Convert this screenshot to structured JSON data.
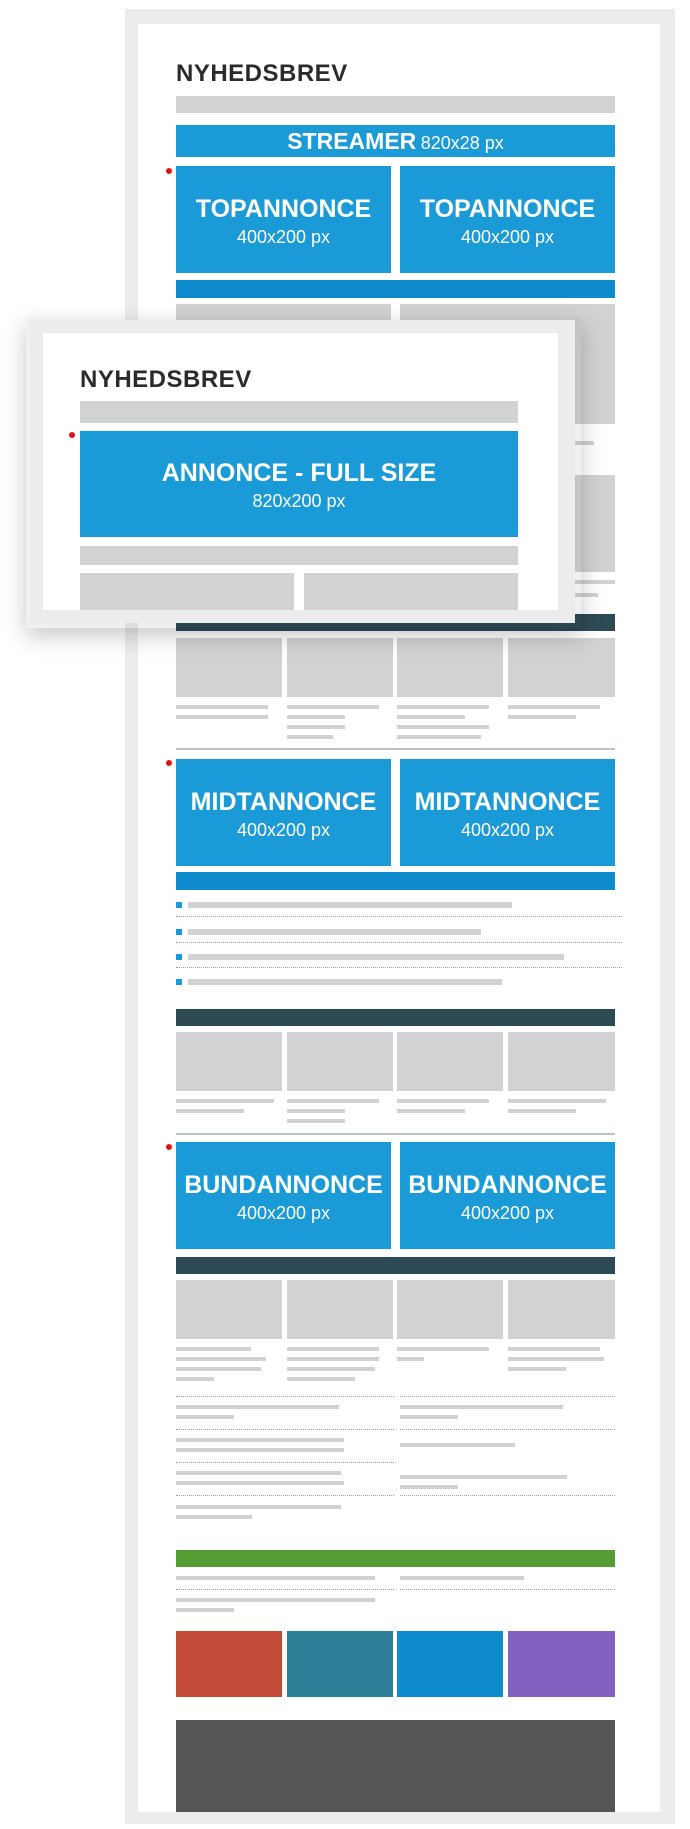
{
  "newsletter": {
    "title": "NYHEDSBREV",
    "streamer": {
      "label": "STREAMER",
      "size": "820x28 px"
    },
    "top_ads": [
      {
        "label": "TOPANNONCE",
        "size": "400x200 px"
      },
      {
        "label": "TOPANNONCE",
        "size": "400x200 px"
      }
    ],
    "mid_ads": [
      {
        "label": "MIDTANNONCE",
        "size": "400x200 px"
      },
      {
        "label": "MIDTANNONCE",
        "size": "400x200 px"
      }
    ],
    "bottom_ads": [
      {
        "label": "BUNDANNONCE",
        "size": "400x200 px"
      },
      {
        "label": "BUNDANNONCE",
        "size": "400x200 px"
      }
    ]
  },
  "overlay": {
    "title": "NYHEDSBREV",
    "full_ad": {
      "label": "ANNONCE - FULL SIZE",
      "size": "820x200 px"
    }
  },
  "colors": {
    "ad_blue": "#1a9ad6",
    "section_dark": "#2e4b55",
    "green_bar": "#559e35",
    "tile_red": "#c24b38",
    "tile_teal": "#2c7f97",
    "tile_blue": "#0e8bcc",
    "tile_purple": "#8261c1",
    "footer": "#555555",
    "marker_red": "#e0131b"
  }
}
